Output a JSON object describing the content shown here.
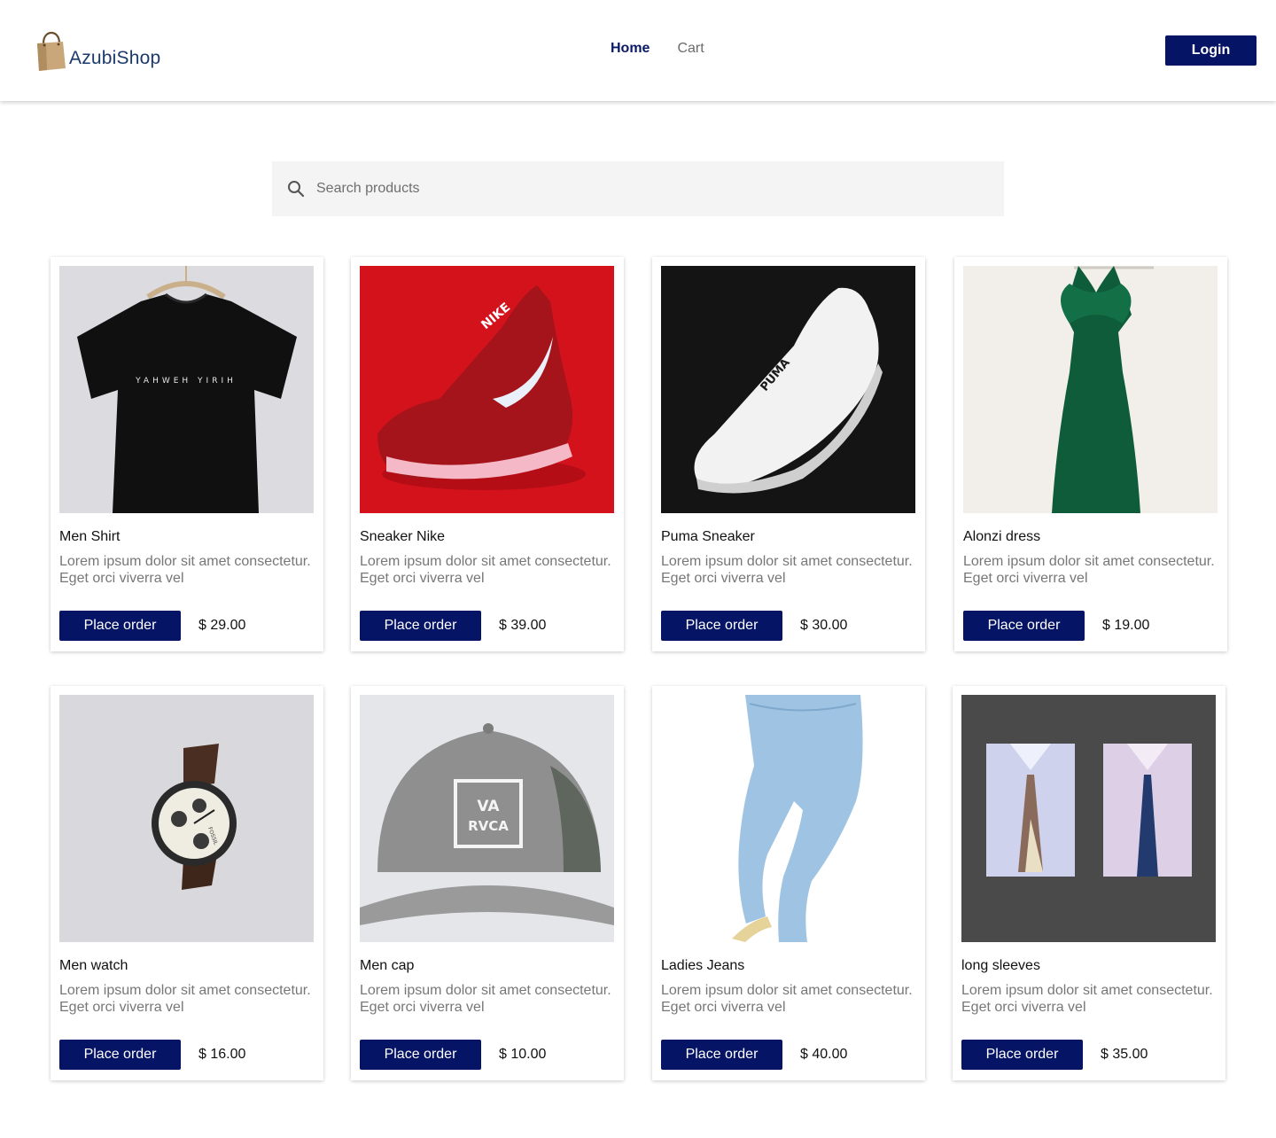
{
  "header": {
    "logo_text": "AzubiShop",
    "nav": {
      "home": "Home",
      "cart": "Cart"
    },
    "login_label": "Login",
    "brand_color": "#061466"
  },
  "search": {
    "placeholder": "Search products",
    "value": ""
  },
  "products": [
    {
      "title": "Men Shirt",
      "desc": "Lorem ipsum dolor sit amet consectetur. Eget orci viverra vel",
      "button": "Place order",
      "price": "$ 29.00",
      "image": "black-tshirt",
      "shirt_text": "YAHWEH YIRIH"
    },
    {
      "title": "Sneaker Nike",
      "desc": "Lorem ipsum dolor sit amet consectetur. Eget orci viverra vel",
      "button": "Place order",
      "price": "$ 39.00",
      "image": "red-sneaker",
      "shoe_text": "NIKE"
    },
    {
      "title": "Puma Sneaker",
      "desc": "Lorem ipsum dolor sit amet consectetur. Eget orci viverra vel",
      "button": "Place order",
      "price": "$ 30.00",
      "image": "white-sneaker",
      "shoe_text": "PUMA"
    },
    {
      "title": "Alonzi dress",
      "desc": "Lorem ipsum dolor sit amet consectetur. Eget orci viverra vel",
      "button": "Place order",
      "price": "$ 19.00",
      "image": "green-dress"
    },
    {
      "title": "Men watch",
      "desc": "Lorem ipsum dolor sit amet consectetur. Eget orci viverra vel",
      "button": "Place order",
      "price": "$ 16.00",
      "image": "watch",
      "watch_text": "FOSSIL"
    },
    {
      "title": "Men cap",
      "desc": "Lorem ipsum dolor sit amet consectetur. Eget orci viverra vel",
      "button": "Place order",
      "price": "$ 10.00",
      "image": "grey-cap",
      "cap_text_1": "VA",
      "cap_text_2": "RVCA"
    },
    {
      "title": "Ladies Jeans",
      "desc": "Lorem ipsum dolor sit amet consectetur. Eget orci viverra vel",
      "button": "Place order",
      "price": "$ 40.00",
      "image": "jeans"
    },
    {
      "title": "long sleeves",
      "desc": "Lorem ipsum dolor sit amet consectetur. Eget orci viverra vel",
      "button": "Place order",
      "price": "$ 35.00",
      "image": "dress-shirts"
    }
  ]
}
